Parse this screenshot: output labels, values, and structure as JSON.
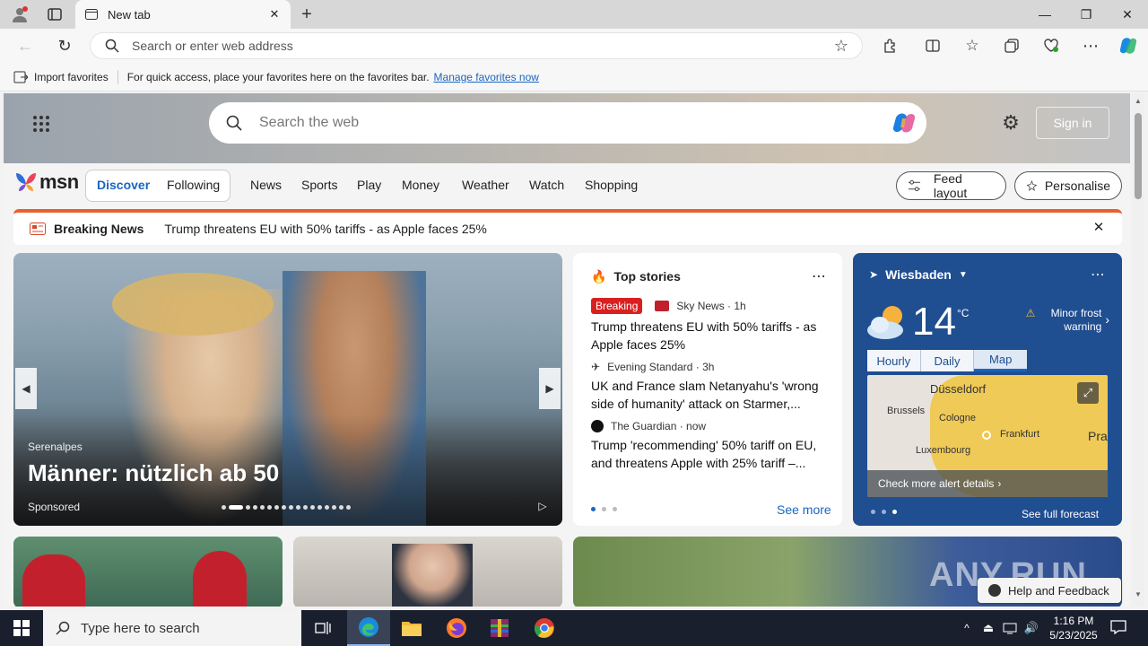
{
  "browser": {
    "tab_title": "New tab",
    "address_placeholder": "Search or enter web address",
    "favorites": {
      "import_label": "Import favorites",
      "hint": "For quick access, place your favorites here on the favorites bar.",
      "manage_link": "Manage favorites now"
    }
  },
  "msn": {
    "search_placeholder": "Search the web",
    "sign_in": "Sign in",
    "logo": "msn",
    "tabs": [
      "Discover",
      "Following"
    ],
    "nav": [
      "News",
      "Sports",
      "Play",
      "Money",
      "Weather",
      "Watch",
      "Shopping"
    ],
    "feed_layout": "Feed layout",
    "personalise": "Personalise",
    "breaking": {
      "label": "Breaking News",
      "headline": "Trump threatens EU with 50% tariffs - as Apple faces 25%"
    },
    "carousel": {
      "source": "Serenalpes",
      "title": "Männer: nützlich ab 50",
      "sponsored": "Sponsored"
    },
    "top_stories": {
      "title": "Top stories",
      "see_more": "See more",
      "items": [
        {
          "badge": "Breaking",
          "source": "Sky News · 1h",
          "headline": "Trump threatens EU with 50% tariffs - as Apple faces 25%"
        },
        {
          "badge": "",
          "source": "Evening Standard · 3h",
          "headline": "UK and France slam Netanyahu's 'wrong side of humanity' attack on Starmer,..."
        },
        {
          "badge": "",
          "source": "The Guardian · now",
          "headline": "Trump 'recommending' 50% tariff on EU, and threatens Apple with 25% tariff –..."
        }
      ]
    },
    "weather": {
      "city": "Wiesbaden",
      "temp": "14",
      "unit": "°C",
      "alert": "Minor frost warning",
      "tabs": [
        "Hourly",
        "Daily",
        "Map"
      ],
      "map_labels": [
        "Düsseldorf",
        "Brussels",
        "Cologne",
        "Frankfurt",
        "Luxembourg",
        "Pra"
      ],
      "alert_details": "Check more alert details",
      "full_forecast": "See full forecast"
    },
    "help": "Help and Feedback",
    "watermark": "ANY.RUN"
  },
  "taskbar": {
    "search_placeholder": "Type here to search",
    "time": "1:16 PM",
    "date": "5/23/2025"
  },
  "colors": {
    "accent": "#1a66c0",
    "breaking_red": "#d92020",
    "weather_bg": "#1f4e91",
    "taskbar": "#1a1f2e"
  }
}
